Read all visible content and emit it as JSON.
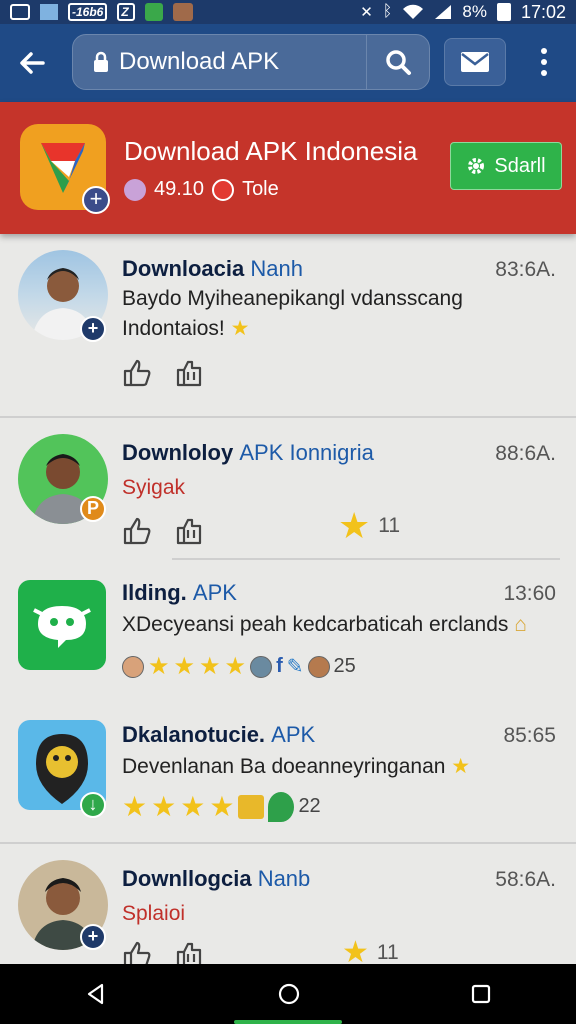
{
  "status_bar": {
    "left_items": [
      "-16b6",
      "Z"
    ],
    "battery": "8%",
    "time": "17:02"
  },
  "app_bar": {
    "search_value": "Download APK"
  },
  "banner": {
    "title": "Download APK Indonesia",
    "rating": "49.10",
    "meta_label": "Tole",
    "button_label": "Sdarll",
    "bg_color": "#c5342a",
    "button_color": "#2fb34a"
  },
  "feed": {
    "items": [
      {
        "title": "Downloacia",
        "title_accent": "Nanh",
        "time": "83:6A.",
        "body_line1": "Baydo Myiheanepikangl vdansscang",
        "body_line2": "Indontaios!"
      },
      {
        "title": "Downloloy",
        "title_accent": "APK Ionnigria",
        "time": "88:6A.",
        "subtitle": "Syigak",
        "star_count": "11"
      },
      {
        "title": "Ilding.",
        "title_accent": "APK",
        "time": "13:60",
        "body_line1": "XDecyeansi peah kedcarbaticah erclands",
        "rating_count": "25"
      },
      {
        "title": "Dkalanotucie.",
        "title_accent": "APK",
        "time": "85:65",
        "body_line1": "Devenlanan Ba doeanneyringanan",
        "rating_count": "22"
      },
      {
        "title": "Downllogcia",
        "title_accent": "Nanb",
        "time": "58:6A.",
        "subtitle": "Splaioi",
        "star_count": "11"
      }
    ]
  }
}
